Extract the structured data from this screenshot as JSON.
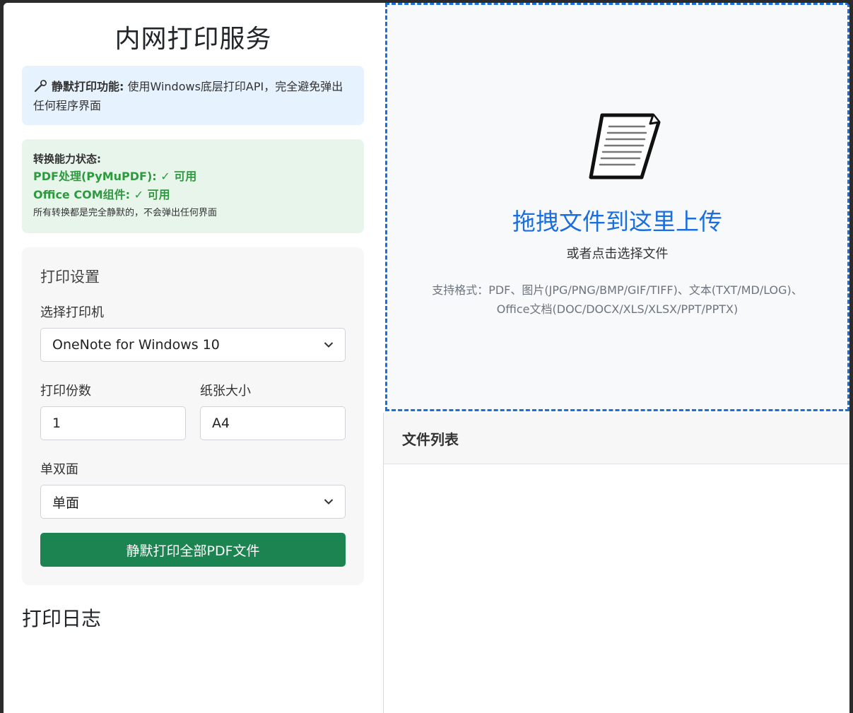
{
  "page": {
    "title": "内网打印服务"
  },
  "info": {
    "label": "静默打印功能:",
    "text": "使用Windows底层打印API，完全避免弹出任何程序界面"
  },
  "status": {
    "title": "转换能力状态:",
    "pdf": "PDF处理(PyMuPDF): ✓ 可用",
    "office": "Office COM组件: ✓ 可用",
    "note": "所有转换都是完全静默的，不会弹出任何界面"
  },
  "settings": {
    "title": "打印设置",
    "printer_label": "选择打印机",
    "printer_value": "OneNote for Windows 10",
    "copies_label": "打印份数",
    "copies_value": "1",
    "paper_label": "纸张大小",
    "paper_value": "A4",
    "duplex_label": "单双面",
    "duplex_value": "单面",
    "print_button": "静默打印全部PDF文件"
  },
  "log": {
    "title": "打印日志"
  },
  "upload": {
    "title": "拖拽文件到这里上传",
    "subtitle": "或者点击选择文件",
    "formats_line1": "支持格式：PDF、图片(JPG/PNG/BMP/GIF/TIFF)、文本(TXT/MD/LOG)、",
    "formats_line2": "Office文档(DOC/DOCX/XLS/XLSX/PPT/PPTX)"
  },
  "file_list": {
    "title": "文件列表"
  },
  "colors": {
    "accent": "#1a6fdc",
    "success": "#2e9a3f",
    "button": "#1c8451",
    "info_bg": "#e6f2fd",
    "status_bg": "#e8f5ea"
  },
  "icons": {
    "info": "wrench-icon",
    "upload": "document-icon",
    "select": "chevron-down-icon"
  }
}
